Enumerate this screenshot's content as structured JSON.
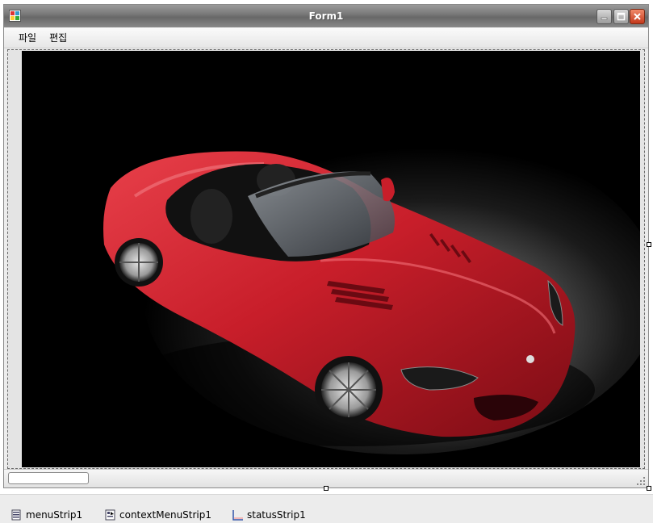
{
  "form": {
    "title": "Form1"
  },
  "menu": {
    "items": [
      {
        "label": "파일"
      },
      {
        "label": "편집"
      }
    ]
  },
  "component_tray": {
    "items": [
      {
        "label": "menuStrip1",
        "icon": "menu-strip-icon"
      },
      {
        "label": "contextMenuStrip1",
        "icon": "context-menu-strip-icon"
      },
      {
        "label": "statusStrip1",
        "icon": "status-strip-icon"
      }
    ]
  },
  "picture": {
    "subject": "red-convertible-car-image"
  },
  "colors": {
    "title_bar": "#7a7a7a",
    "car_body": "#c8202c",
    "close_button": "#c4391c"
  }
}
